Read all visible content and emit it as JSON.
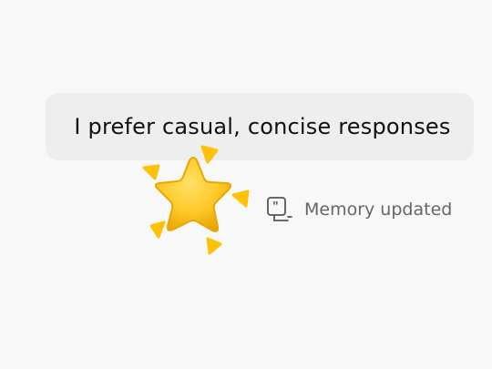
{
  "message": {
    "text": "I prefer casual, concise responses"
  },
  "status": {
    "icon": "memory-icon",
    "text": "Memory updated"
  },
  "decoration": {
    "icon": "sparkle-star-icon",
    "colors": {
      "star": "#ffc928",
      "star_shadow": "#e8a800",
      "spark": "#ffc107"
    }
  }
}
